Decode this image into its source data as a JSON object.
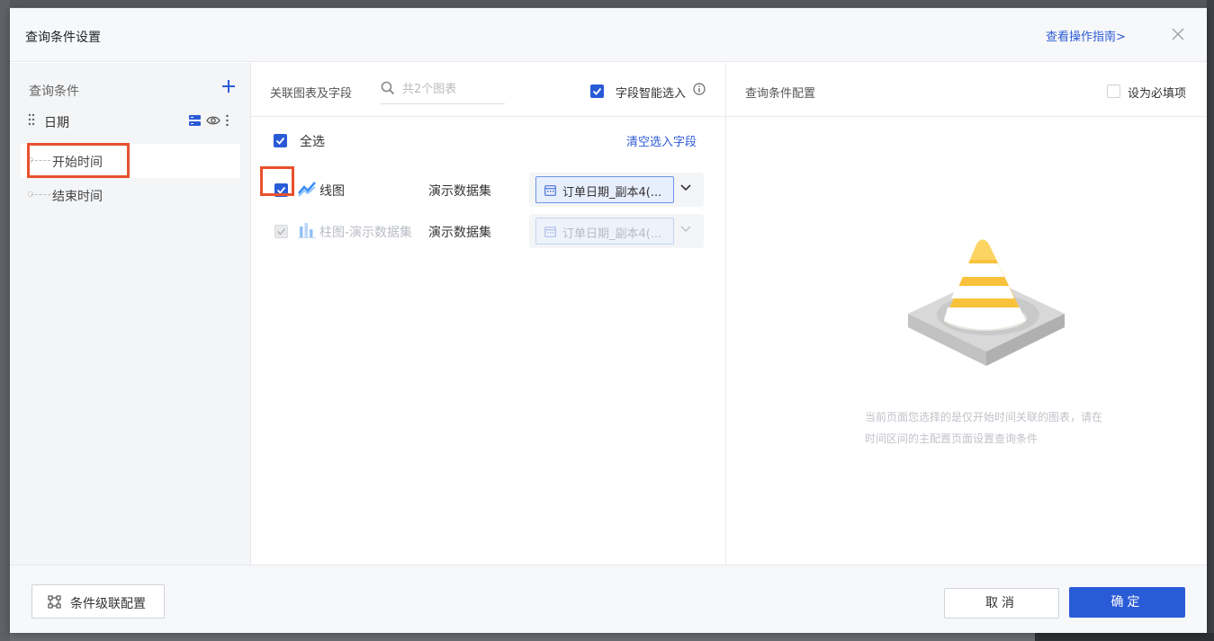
{
  "dialog": {
    "title": "查询条件设置",
    "guide_link": "查看操作指南>"
  },
  "left": {
    "title": "查询条件",
    "condition": "日期",
    "sub_items": [
      {
        "label": "开始时间",
        "active": true
      },
      {
        "label": "结束时间",
        "active": false
      }
    ]
  },
  "middle": {
    "title": "关联图表及字段",
    "search_placeholder": "共2个图表",
    "smart_select_label": "字段智能选入",
    "select_all_label": "全选",
    "clear_link": "清空选入字段",
    "charts": [
      {
        "name": "线图",
        "dataset": "演示数据集",
        "field": "订单日期_副本4(...",
        "checked": true,
        "disabled": false,
        "icon": "line-chart-icon"
      },
      {
        "name": "柱图-演示数据集",
        "dataset": "演示数据集",
        "field": "订单日期_副本4(...",
        "checked": true,
        "disabled": true,
        "icon": "bar-chart-icon"
      }
    ]
  },
  "right": {
    "title": "查询条件配置",
    "required_label": "设为必填项",
    "empty_message": "当前页面您选择的是仅开始时间关联的图表，请在时间区间的主配置页面设置查询条件"
  },
  "footer": {
    "cascade_label": "条件级联配置",
    "cancel_label": "取消",
    "ok_label": "确定"
  },
  "colors": {
    "primary": "#2a5bd7",
    "link": "#2f5bd6",
    "highlight": "#e8502d",
    "cone": "#f9c23c"
  }
}
